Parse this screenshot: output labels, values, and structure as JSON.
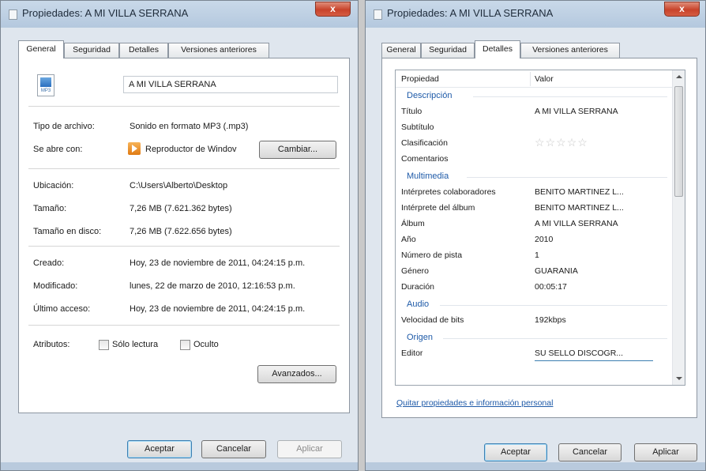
{
  "left_window": {
    "title": "Propiedades: A MI VILLA SERRANA",
    "close_glyph": "x",
    "tabs": [
      {
        "label": "General",
        "active": true
      },
      {
        "label": "Seguridad",
        "active": false
      },
      {
        "label": "Detalles",
        "active": false
      },
      {
        "label": "Versiones anteriores",
        "active": false
      }
    ],
    "file_icon": "mp3-file-icon",
    "file_icon_caption": "MP3",
    "file_name": "A MI VILLA SERRANA",
    "rows": {
      "tipo_label": "Tipo de archivo:",
      "tipo_value": "Sonido en formato MP3 (.mp3)",
      "abre_label": "Se abre con:",
      "abre_value": "Reproductor de Windov",
      "abre_icon": "media-player-icon",
      "cambiar_label": "Cambiar...",
      "ubicacion_label": "Ubicación:",
      "ubicacion_value": "C:\\Users\\Alberto\\Desktop",
      "tamano_label": "Tamaño:",
      "tamano_value": "7,26 MB (7.621.362 bytes)",
      "tamano_disco_label": "Tamaño en disco:",
      "tamano_disco_value": "7,26 MB (7.622.656 bytes)",
      "creado_label": "Creado:",
      "creado_value": "Hoy, 23 de noviembre de 2011, 04:24:15 p.m.",
      "modificado_label": "Modificado:",
      "modificado_value": "lunes, 22 de marzo de 2010, 12:16:53 p.m.",
      "acceso_label": "Último acceso:",
      "acceso_value": "Hoy, 23 de noviembre de 2011, 04:24:15 p.m.",
      "atributos_label": "Atributos:",
      "solo_lectura_label": "Sólo lectura",
      "oculto_label": "Oculto",
      "avanzados_label": "Avanzados..."
    },
    "buttons": {
      "aceptar": "Aceptar",
      "cancelar": "Cancelar",
      "aplicar": "Aplicar"
    }
  },
  "right_window": {
    "title": "Propiedades: A MI VILLA SERRANA",
    "close_glyph": "x",
    "tabs": [
      {
        "label": "General",
        "active": false
      },
      {
        "label": "Seguridad",
        "active": false
      },
      {
        "label": "Detalles",
        "active": true
      },
      {
        "label": "Versiones anteriores",
        "active": false
      }
    ],
    "columns": {
      "propiedad": "Propiedad",
      "valor": "Valor"
    },
    "groups": {
      "descripcion": "Descripción",
      "multimedia": "Multimedia",
      "audio": "Audio",
      "origen": "Origen"
    },
    "descripcion_rows": [
      {
        "k": "Título",
        "v": "A MI VILLA SERRANA"
      },
      {
        "k": "Subtítulo",
        "v": ""
      },
      {
        "k": "Clasificación",
        "v": "",
        "rating_stars": 0,
        "rating_max": 5
      },
      {
        "k": "Comentarios",
        "v": ""
      }
    ],
    "multimedia_rows": [
      {
        "k": "Intérpretes colaboradores",
        "v": "BENITO MARTINEZ L..."
      },
      {
        "k": "Intérprete del álbum",
        "v": "BENITO MARTINEZ L..."
      },
      {
        "k": "Álbum",
        "v": "A MI VILLA SERRANA"
      },
      {
        "k": "Año",
        "v": "2010"
      },
      {
        "k": "Número de pista",
        "v": "1"
      },
      {
        "k": "Género",
        "v": "GUARANIA"
      },
      {
        "k": "Duración",
        "v": "00:05:17"
      }
    ],
    "audio_rows": [
      {
        "k": "Velocidad de bits",
        "v": "192kbps"
      }
    ],
    "origen_rows": [
      {
        "k": "Editor",
        "v": "SU SELLO DISCOGR..."
      }
    ],
    "link": "Quitar propiedades e información personal",
    "buttons": {
      "aceptar": "Aceptar",
      "cancelar": "Cancelar",
      "aplicar": "Aplicar"
    }
  },
  "colors": {
    "accent_link": "#1e5aa8",
    "close_red": "#c8432b"
  }
}
